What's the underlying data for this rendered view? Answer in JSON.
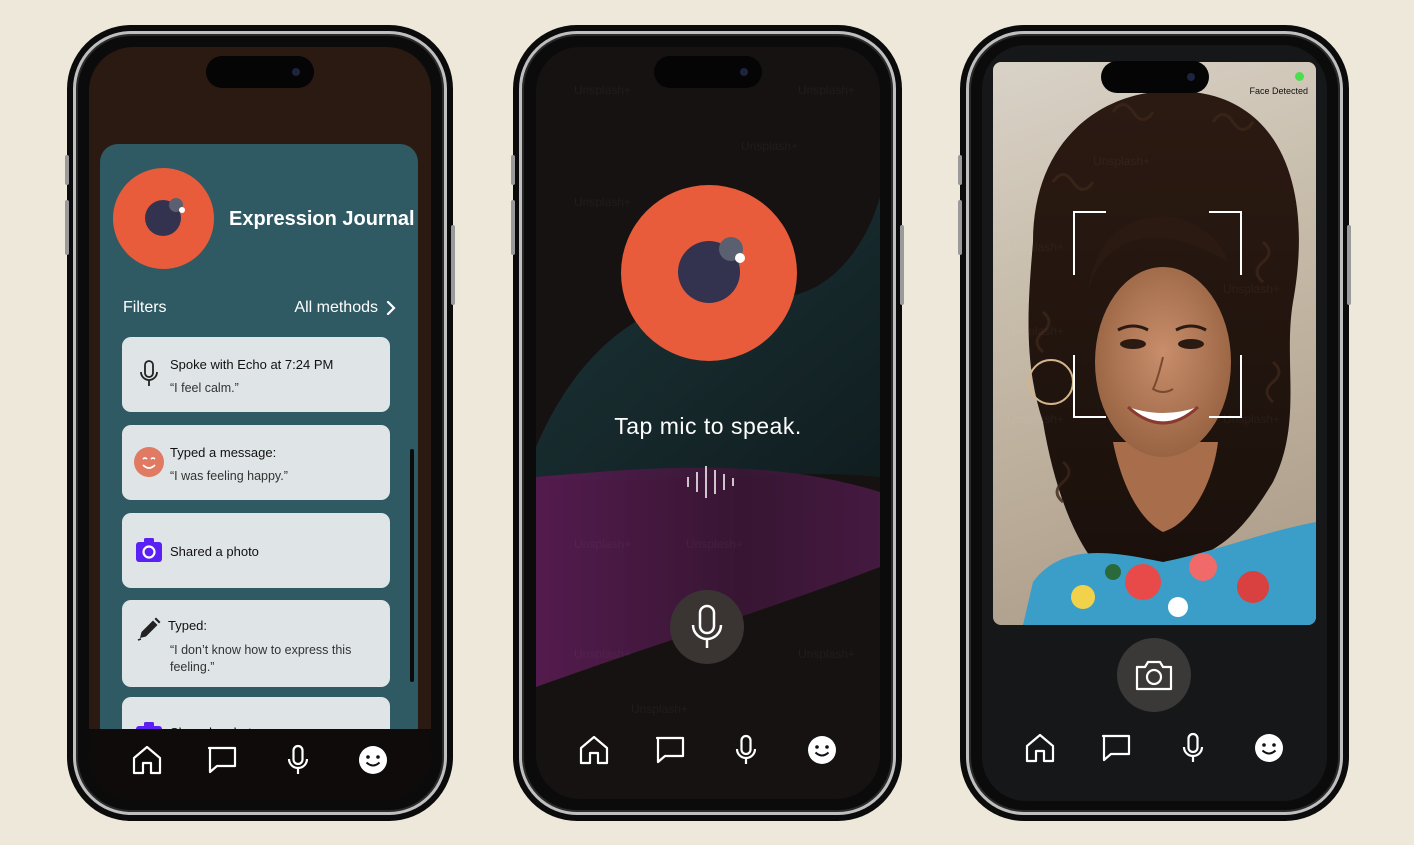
{
  "colors": {
    "background": "#ede8da",
    "journal_card": "#2f5a64",
    "logo_orange": "#e85c3c",
    "logo_navy": "#33334f",
    "entry_bg": "#dfe4e6",
    "photo_icon": "#5b21f4",
    "face_detected": "#4cde4c"
  },
  "tabbar": {
    "items": [
      {
        "icon": "home-icon"
      },
      {
        "icon": "chat-icon"
      },
      {
        "icon": "mic-icon"
      },
      {
        "icon": "smile-icon"
      }
    ]
  },
  "journal": {
    "title": "Expression Journal",
    "filters_label": "Filters",
    "all_methods_label": "All methods",
    "entries": [
      {
        "icon": "mic-icon",
        "line1": "Spoke with Echo at 7:24 PM",
        "line2": "“I feel calm.”"
      },
      {
        "icon": "smile-face-icon",
        "line1": "Typed a message:",
        "line2": "“I was feeling happy.”"
      },
      {
        "icon": "camera-icon",
        "line1": "Shared a photo",
        "line2": ""
      },
      {
        "icon": "pencil-icon",
        "line1": "Typed:",
        "line2": "“I don’t know how to express this",
        "line3": "feeling.”"
      },
      {
        "icon": "camera-icon",
        "line1": "Shared a photo",
        "line2": ""
      }
    ]
  },
  "voice": {
    "prompt": "Tap mic to speak.",
    "watermark": "Unsplash+"
  },
  "camera": {
    "status": "Face Detected",
    "watermark": "Unsplash+"
  }
}
